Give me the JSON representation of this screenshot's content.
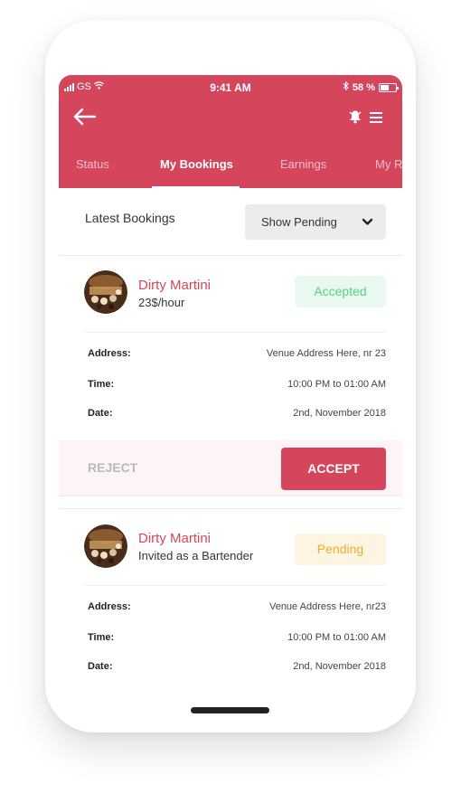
{
  "status_bar": {
    "carrier": "GS",
    "time": "9:41 AM",
    "battery_percent": "58 %",
    "battery_level": 0.58
  },
  "nav": {
    "back_icon": "arrow-left-icon",
    "bell_icon": "bell-icon",
    "menu_icon": "hamburger-menu-icon"
  },
  "tabs": [
    {
      "label": "Status",
      "active": false
    },
    {
      "label": "My Bookings",
      "active": true
    },
    {
      "label": "Earnings",
      "active": false
    },
    {
      "label": "My R",
      "active": false
    }
  ],
  "list_header": {
    "title": "Latest Bookings",
    "filter_value": "Show Pending"
  },
  "detail_labels": {
    "address": "Address:",
    "time": "Time:",
    "date": "Date:"
  },
  "bookings": [
    {
      "venue": "Dirty Martini",
      "subline": "23$/hour",
      "status": "Accepted",
      "address": "Venue Address Here, nr 23",
      "time": "10:00 PM to 01:00 AM",
      "date": "2nd, November 2018",
      "actions": {
        "reject": "REJECT",
        "accept": "ACCEPT"
      }
    },
    {
      "venue": "Dirty Martini",
      "subline": "Invited as a Bartender",
      "status": "Pending",
      "address": "Venue Address Here, nr23",
      "time": "10:00 PM to 01:00 AM",
      "date": "2nd, November 2018"
    }
  ],
  "colors": {
    "brand": "#d5465d",
    "accepted_text": "#59cf8a",
    "accepted_bg": "#eaf9f0",
    "pending_text": "#efaf28",
    "pending_bg": "#fdf5e1"
  }
}
